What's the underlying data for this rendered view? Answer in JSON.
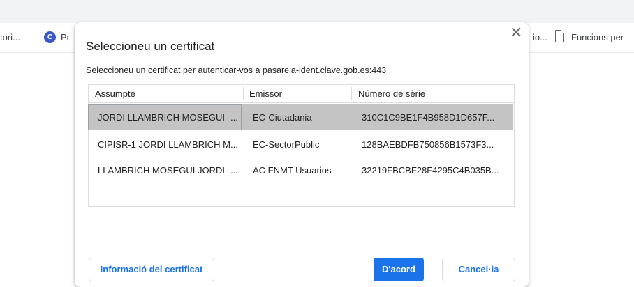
{
  "bookmarks_bar": {
    "left_item": "tori...",
    "logo_letter": "C",
    "pr_item": "Pr",
    "right_item": "io...",
    "funcions_item": "Funcions per"
  },
  "dialog": {
    "title": "Seleccioneu un certificat",
    "subtitle": "Seleccioneu un certificat per autenticar-vos a pasarela-ident.clave.gob.es:443",
    "close_glyph": "✕",
    "columns": [
      "Assumpte",
      "Emissor",
      "Número de sèrie"
    ],
    "rows": [
      {
        "subject": "JORDI LLAMBRICH MOSEGUI -...",
        "issuer": "EC-Ciutadania",
        "serial": "310C1C9BE1F4B958D1D657F...",
        "selected": true
      },
      {
        "subject": "CIPISR-1 JORDI LLAMBRICH M...",
        "issuer": "EC-SectorPublic",
        "serial": "128BAEBDFB750856B1573F3...",
        "selected": false
      },
      {
        "subject": "LLAMBRICH MOSEGUI JORDI -...",
        "issuer": "AC FNMT Usuarios",
        "serial": "32219FBCBF28F4295C4B035B...",
        "selected": false
      }
    ],
    "buttons": {
      "info": "Informació del certificat",
      "ok": "D'acord",
      "cancel": "Cancel·la"
    }
  },
  "colors": {
    "accent": "#1a73e8",
    "selected_row": "#c4c4c4"
  }
}
